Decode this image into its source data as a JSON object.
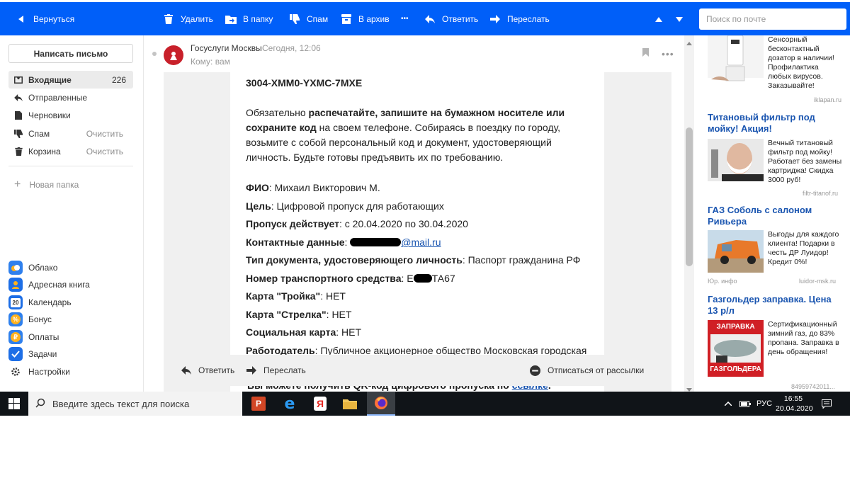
{
  "toolbar": {
    "back": "Вернуться",
    "delete": "Удалить",
    "move": "В папку",
    "spam": "Спам",
    "archive": "В архив",
    "more": "•••",
    "reply": "Ответить",
    "forward": "Переслать",
    "search_placeholder": "Поиск по почте"
  },
  "sidebar": {
    "compose": "Написать письмо",
    "folders": [
      {
        "label": "Входящие",
        "count": "226",
        "active": true,
        "icon": "inbox-icon"
      },
      {
        "label": "Отправленные",
        "icon": "sent-icon"
      },
      {
        "label": "Черновики",
        "icon": "drafts-icon"
      },
      {
        "label": "Спам",
        "action": "Очистить",
        "icon": "spam-icon"
      },
      {
        "label": "Корзина",
        "action": "Очистить",
        "icon": "trash-icon"
      }
    ],
    "new_folder": "Новая папка",
    "services": [
      {
        "label": "Облако",
        "icon": "cloud-icon",
        "color": "#2f80ed"
      },
      {
        "label": "Адресная книга",
        "icon": "contacts-icon",
        "color": "#1d6ee6"
      },
      {
        "label": "Календарь",
        "icon": "calendar-icon",
        "badge": "20",
        "color": "#1d6ee6"
      },
      {
        "label": "Бонус",
        "icon": "bonus-icon",
        "color": "#2f80ed"
      },
      {
        "label": "Оплаты",
        "icon": "payments-icon",
        "color": "#2f80ed"
      },
      {
        "label": "Задачи",
        "icon": "tasks-icon",
        "color": "#1d6ee6"
      },
      {
        "label": "Настройки",
        "icon": "settings-icon"
      }
    ]
  },
  "message": {
    "sender": "Госуслуги Москвы",
    "date": "Сегодня, 12:06",
    "recipient": "Кому: вам",
    "code": "3004-XMM0-YXMC-7MXE",
    "para_pre": "Обязательно ",
    "para_bold": "распечатайте, запишите на бумажном носителе или сохраните код",
    "para_post": " на своем телефоне. Собираясь в поездку по городу, возьмите с собой персональный код и документ, удостоверяющий личность. Будьте готовы предъявить их по требованию.",
    "fields": [
      {
        "label": "ФИО",
        "value": ": Михаил Викторович М."
      },
      {
        "label": "Цель",
        "value": ": Цифровой пропуск для работающих"
      },
      {
        "label": "Пропуск действует",
        "value": ": с 20.04.2020 по 30.04.2020"
      },
      {
        "label": "Контактные данные",
        "value": ": ",
        "link": "@mail.ru"
      },
      {
        "label": "Тип документа, удостоверяющего личность",
        "value": ": Паспорт гражданина РФ"
      },
      {
        "label": "Номер транспортного средства",
        "value": ": Е",
        "tail": "ТА67"
      },
      {
        "label": "Карта \"Тройка\"",
        "value": ": НЕТ"
      },
      {
        "label": "Карта \"Стрелка\"",
        "value": ": НЕТ"
      },
      {
        "label": "Социальная карта",
        "value": ": НЕТ"
      },
      {
        "label": "Работодатель",
        "value": ": Публичное акционерное общество Московская городская"
      }
    ],
    "behind_text": "Вы можете получить QR-код цифрового пропуска по ",
    "behind_link": "ссылке",
    "behind_end": "."
  },
  "actions": {
    "reply": "Ответить",
    "forward": "Переслать",
    "unsubscribe": "Отписаться от рассылки"
  },
  "ads": [
    {
      "title": "",
      "text": "Сенсорный бесконтактный дозатор в наличии! Профилактика любых вирусов. Заказывайте!",
      "source": "iklapan.ru"
    },
    {
      "title": "Титановый фильтр под мойку! Акция!",
      "text": "Вечный титановый фильтр под мойку! Работает без замены картриджа! Скидка 3000 руб!",
      "source": "filtr-titanof.ru"
    },
    {
      "title": "ГАЗ Соболь с салоном Ривьера",
      "text": "Выгоды для каждого клиента! Подарки в честь ДР Луидор! Кредит 0%!",
      "source": "luidor-msk.ru",
      "source_left": "Юр. инфо"
    },
    {
      "title": "Газгольдер заправка. Цена 13 р/л",
      "text": "Сертификационный зимний газ, до 83% пропана. Заправка в день обращения!",
      "source": "84959742011...",
      "img_top": "ЗАПРАВКА",
      "img_bottom": "ГАЗГОЛЬДЕРА"
    }
  ],
  "taskbar": {
    "search_placeholder": "Введите здесь текст для поиска",
    "lang": "РУС",
    "time": "16:55",
    "date": "20.04.2020"
  }
}
